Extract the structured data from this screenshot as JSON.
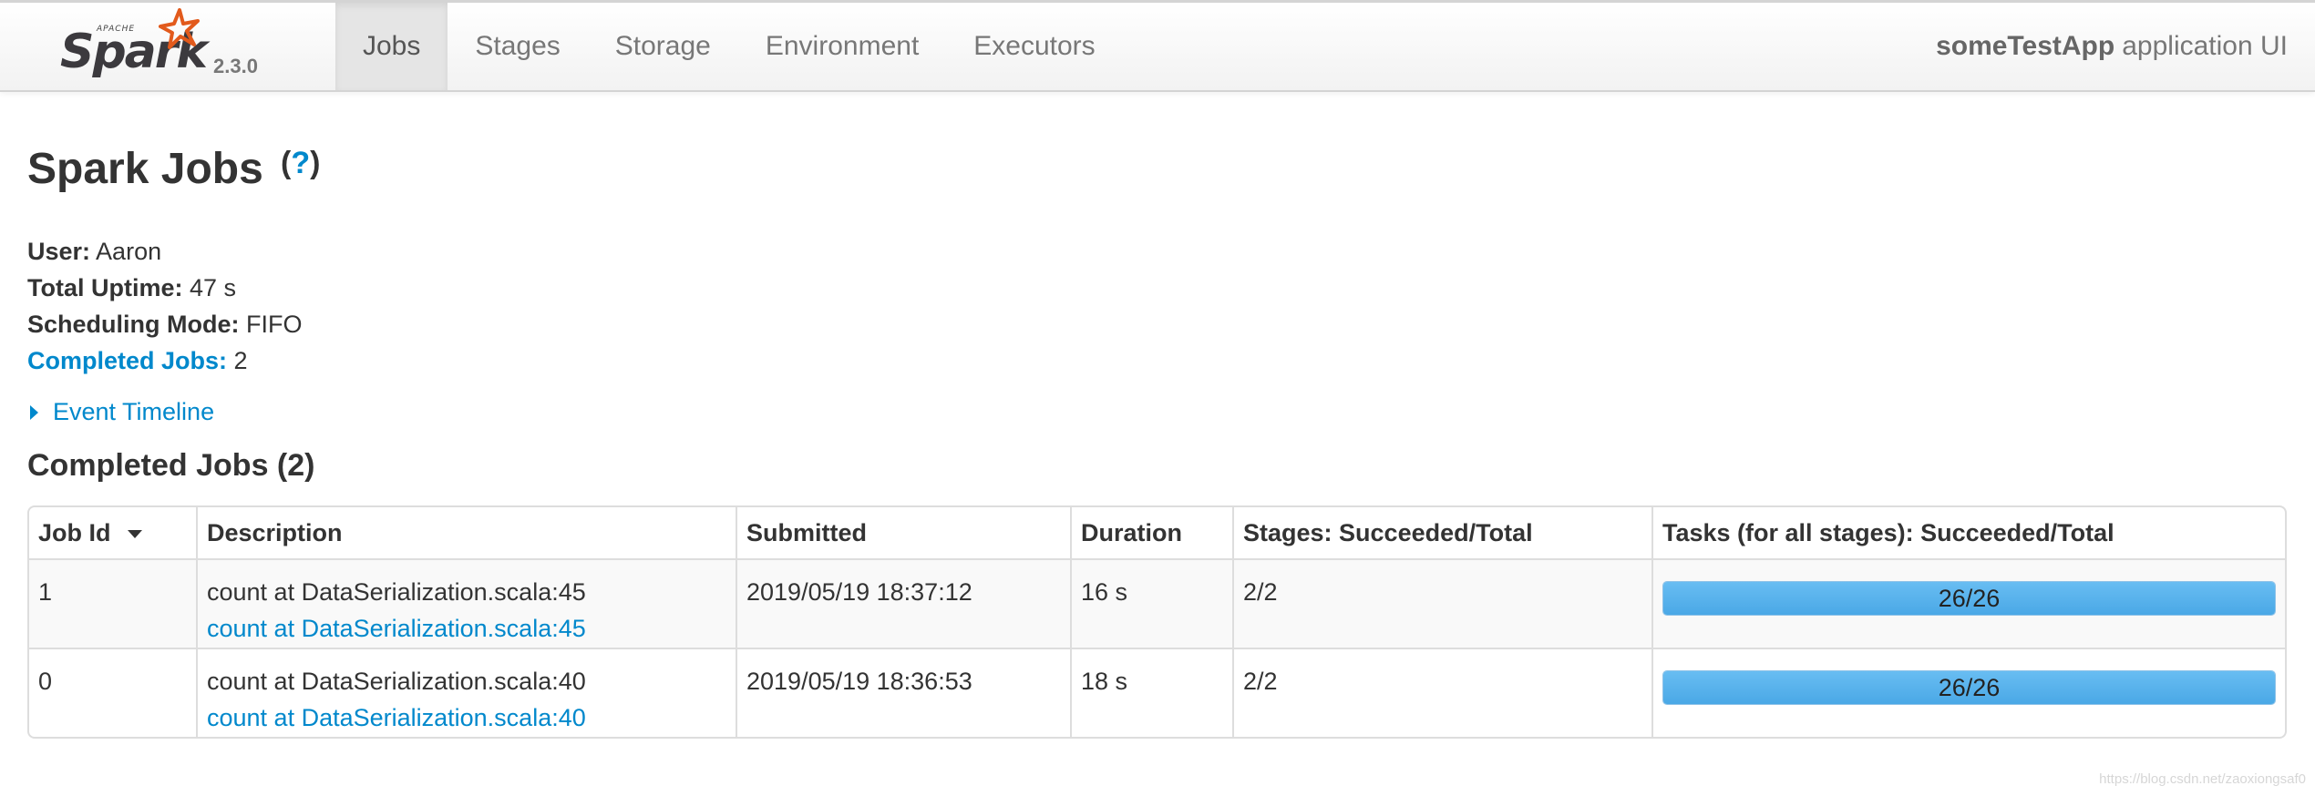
{
  "navbar": {
    "brand": {
      "apache": "APACHE",
      "spark": "Spark",
      "version": "2.3.0"
    },
    "tabs": [
      {
        "label": "Jobs",
        "active": true
      },
      {
        "label": "Stages",
        "active": false
      },
      {
        "label": "Storage",
        "active": false
      },
      {
        "label": "Environment",
        "active": false
      },
      {
        "label": "Executors",
        "active": false
      }
    ],
    "app_name": "someTestApp",
    "app_suffix": "application UI"
  },
  "page": {
    "title": "Spark Jobs",
    "help": {
      "open": "(",
      "mark": "?",
      "close": ")"
    }
  },
  "summary": {
    "user": {
      "label": "User:",
      "value": "Aaron"
    },
    "uptime": {
      "label": "Total Uptime:",
      "value": "47 s"
    },
    "scheduling": {
      "label": "Scheduling Mode:",
      "value": "FIFO"
    },
    "completed": {
      "label": "Completed Jobs:",
      "value": "2"
    }
  },
  "timeline": {
    "label": "Event Timeline"
  },
  "completed_section": {
    "title": "Completed Jobs (2)",
    "columns": [
      "Job Id",
      "Description",
      "Submitted",
      "Duration",
      "Stages: Succeeded/Total",
      "Tasks (for all stages): Succeeded/Total"
    ],
    "rows": [
      {
        "job_id": "1",
        "description": "count at DataSerialization.scala:45",
        "description_link": "count at DataSerialization.scala:45",
        "submitted": "2019/05/19 18:37:12",
        "duration": "16 s",
        "stages": "2/2",
        "tasks": "26/26",
        "tasks_fraction": 1.0
      },
      {
        "job_id": "0",
        "description": "count at DataSerialization.scala:40",
        "description_link": "count at DataSerialization.scala:40",
        "submitted": "2019/05/19 18:36:53",
        "duration": "18 s",
        "stages": "2/2",
        "tasks": "26/26",
        "tasks_fraction": 1.0
      }
    ]
  },
  "watermark": "https://blog.csdn.net/zaoxiongsaf0",
  "colors": {
    "link": "#0088cc",
    "progress": "#4aa8e6",
    "logo_star": "#e25a1c"
  },
  "icons": {
    "logo_star": "spark-star-icon",
    "sort": "sort-desc-icon",
    "expand": "caret-right-icon"
  }
}
